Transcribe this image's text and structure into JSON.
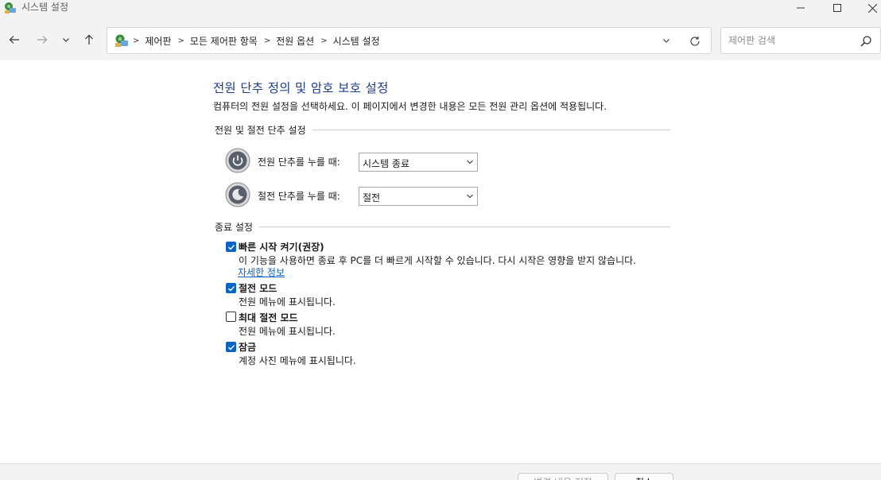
{
  "window": {
    "title": "시스템 설정"
  },
  "nav": {
    "breadcrumbs": [
      "제어판",
      "모든 제어판 항목",
      "전원 옵션",
      "시스템 설정"
    ],
    "search_placeholder": "제어판 검색"
  },
  "content": {
    "title": "전원 단추 정의 및 암호 보호 설정",
    "description": "컴퓨터의 전원 설정을 선택하세요. 이 페이지에서 변경한 내용은 모든 전원 관리 옵션에 적용됩니다.",
    "power_section": {
      "heading": "전원 및 절전 단추 설정",
      "power_button": {
        "label": "전원 단추를 누를 때:",
        "value": "시스템 종료"
      },
      "sleep_button": {
        "label": "절전 단추를 누를 때:",
        "value": "절전"
      }
    },
    "shutdown_section": {
      "heading": "종료 설정",
      "options": [
        {
          "title": "빠른 시작 켜기(권장)",
          "checked": true,
          "description": "이 기능을 사용하면 종료 후 PC를 더 빠르게 시작할 수 있습니다. 다시 시작은 영향을 받지 않습니다.",
          "link": "자세한 정보"
        },
        {
          "title": "절전 모드",
          "checked": true,
          "description": "전원 메뉴에 표시됩니다."
        },
        {
          "title": "최대 절전 모드",
          "checked": false,
          "description": "전원 메뉴에 표시됩니다."
        },
        {
          "title": "잠금",
          "checked": true,
          "description": "계정 사진 메뉴에 표시됩니다."
        }
      ]
    }
  },
  "footer": {
    "save_label": "변경 내용 저장",
    "cancel_label": "취소"
  },
  "colors": {
    "accent": "#0a64c6",
    "title": "#1e3e8a",
    "link": "#0b63c5"
  }
}
